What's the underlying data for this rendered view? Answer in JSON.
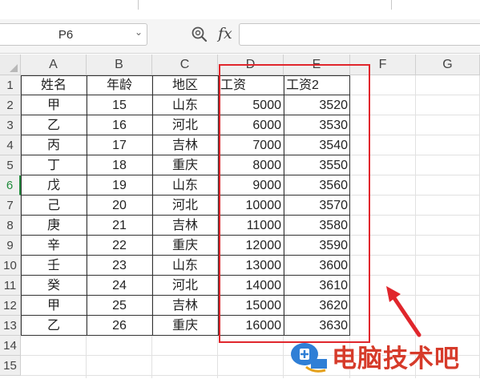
{
  "toolbar": {
    "name_box": "P6",
    "fx_label": "fx",
    "formula_value": ""
  },
  "sheet": {
    "columns": [
      "A",
      "B",
      "C",
      "D",
      "E",
      "F",
      "G"
    ],
    "rows": [
      "1",
      "2",
      "3",
      "4",
      "5",
      "6",
      "7",
      "8",
      "9",
      "10",
      "11",
      "12",
      "13",
      "14",
      "15"
    ],
    "active_row": "6",
    "table": [
      [
        "姓名",
        "年龄",
        "地区",
        "工资",
        "工资2"
      ],
      [
        "甲",
        "15",
        "山东",
        "5000",
        "3520"
      ],
      [
        "乙",
        "16",
        "河北",
        "6000",
        "3530"
      ],
      [
        "丙",
        "17",
        "吉林",
        "7000",
        "3540"
      ],
      [
        "丁",
        "18",
        "重庆",
        "8000",
        "3550"
      ],
      [
        "戊",
        "19",
        "山东",
        "9000",
        "3560"
      ],
      [
        "己",
        "20",
        "河北",
        "10000",
        "3570"
      ],
      [
        "庚",
        "21",
        "吉林",
        "11000",
        "3580"
      ],
      [
        "辛",
        "22",
        "重庆",
        "12000",
        "3590"
      ],
      [
        "壬",
        "23",
        "山东",
        "13000",
        "3600"
      ],
      [
        "癸",
        "24",
        "河北",
        "14000",
        "3610"
      ],
      [
        "甲",
        "25",
        "吉林",
        "15000",
        "3620"
      ],
      [
        "乙",
        "26",
        "重庆",
        "16000",
        "3630"
      ]
    ]
  },
  "annotation": {
    "highlight_color": "#e0262c"
  },
  "watermark": {
    "text": "电脑技术吧"
  }
}
